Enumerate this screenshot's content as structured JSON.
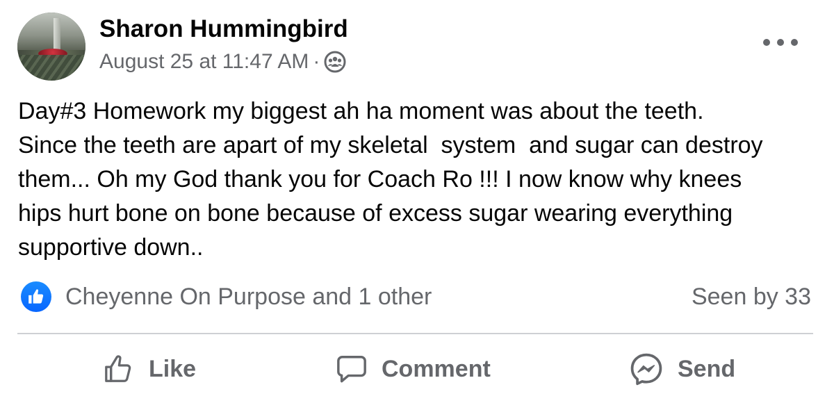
{
  "post": {
    "author": "Sharon Hummingbird",
    "timestamp": "August 25 at 11:47 AM",
    "meta_separator": "·",
    "privacy_icon": "group-icon",
    "text": "Day#3 Homework my biggest ah ha moment was about the teeth.\nSince the teeth are apart of my skeletal  system  and sugar can destroy\nthem... Oh my God thank you for Coach Ro !!! I now know why knees\nhips hurt bone on bone because of excess sugar wearing everything\nsupportive down.."
  },
  "reactions": {
    "icon": "like-icon",
    "summary": "Cheyenne On Purpose and 1 other",
    "seen_by": "Seen by 33"
  },
  "actions": {
    "like_label": "Like",
    "comment_label": "Comment",
    "send_label": "Send"
  },
  "colors": {
    "accent": "#0866ff",
    "secondary_text": "#65676b",
    "primary_text": "#050505",
    "divider": "#ced0d4"
  }
}
